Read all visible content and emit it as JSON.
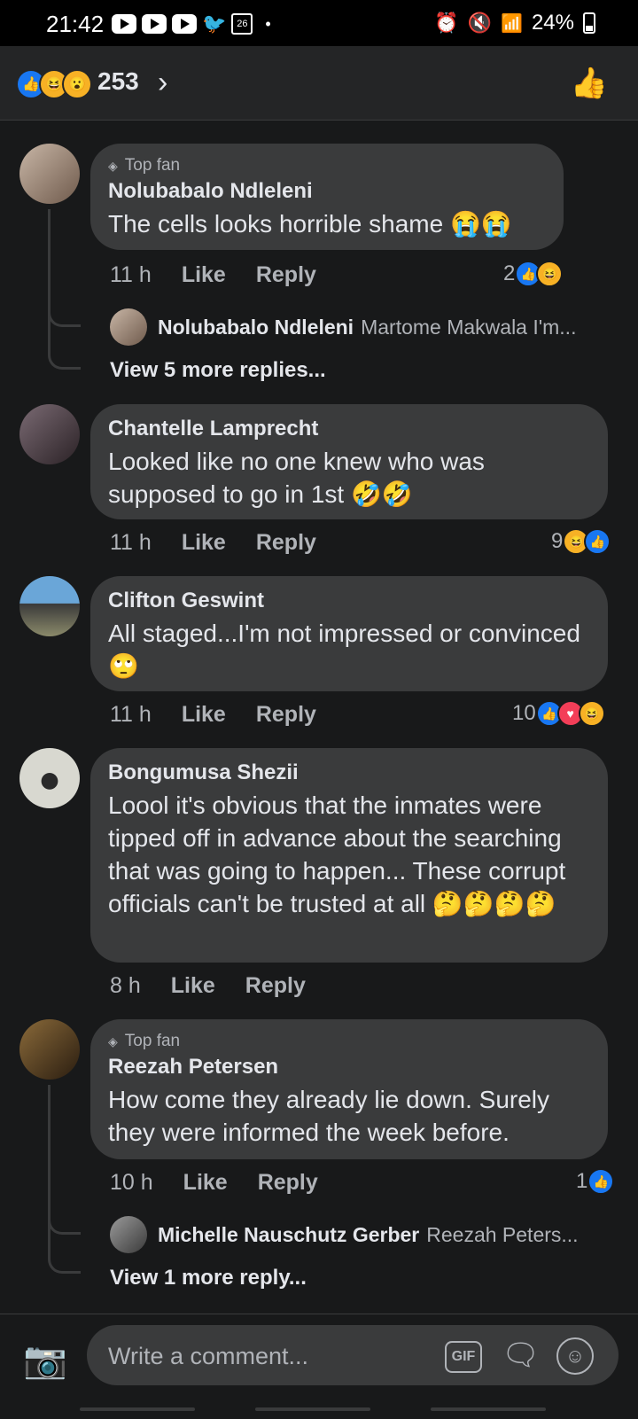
{
  "status_bar": {
    "time": "21:42",
    "calendar_day": "26",
    "battery": "24%"
  },
  "header": {
    "reaction_count": "253"
  },
  "comments": [
    {
      "top_fan": true,
      "top_fan_label": "Top fan",
      "author": "Nolubabalo Ndleleni",
      "text": "The cells looks horrible shame 😭😭",
      "time": "11 h",
      "like": "Like",
      "reply": "Reply",
      "reaction_count": "2",
      "reactions": [
        "like-icon",
        "haha-icon"
      ],
      "reply_preview": {
        "author": "Nolubabalo Ndleleni",
        "text": "Martome Makwala I'm..."
      },
      "more_replies": "View 5 more replies..."
    },
    {
      "top_fan": false,
      "author": "Chantelle Lamprecht",
      "text": "Looked like no one knew who was supposed to go in 1st 🤣🤣",
      "time": "11 h",
      "like": "Like",
      "reply": "Reply",
      "reaction_count": "9",
      "reactions": [
        "haha-icon",
        "like-icon"
      ]
    },
    {
      "top_fan": false,
      "author": "Clifton Geswint",
      "text": "All staged...I'm not impressed or convinced 🙄",
      "time": "11 h",
      "like": "Like",
      "reply": "Reply",
      "reaction_count": "10",
      "reactions": [
        "like-icon",
        "love-icon",
        "haha-icon"
      ]
    },
    {
      "top_fan": false,
      "author": "Bongumusa Shezii",
      "text": "Loool it's obvious that the inmates were tipped off in advance about the searching that was going to happen... These corrupt officials can't be trusted at all 🤔🤔🤔🤔",
      "time": "8 h",
      "like": "Like",
      "reply": "Reply"
    },
    {
      "top_fan": true,
      "top_fan_label": "Top fan",
      "author": "Reezah Petersen",
      "text": "How come they already lie down. Surely they were informed the week before.",
      "time": "10 h",
      "like": "Like",
      "reply": "Reply",
      "reaction_count": "1",
      "reactions": [
        "like-icon"
      ],
      "reply_preview": {
        "author": "Michelle Nauschutz Gerber",
        "text": "Reezah Peters..."
      },
      "more_replies": "View 1 more reply..."
    }
  ],
  "composer": {
    "placeholder": "Write a comment...",
    "gif_label": "GIF"
  },
  "colors": {
    "background": "#18191a",
    "bubble": "#3a3b3c",
    "like_blue": "#1877f2",
    "love_red": "#f33e58",
    "haha_yellow": "#f7b125"
  }
}
